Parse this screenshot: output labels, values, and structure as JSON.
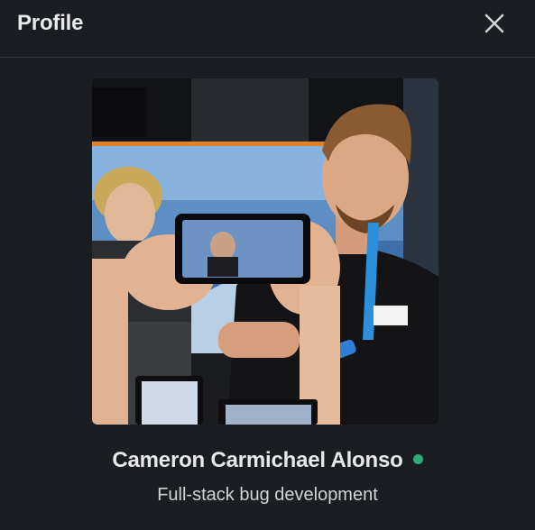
{
  "header": {
    "title": "Profile",
    "close_icon": "close-icon"
  },
  "profile": {
    "photo_alt": "Profile photo",
    "name": "Cameron Carmichael Alonso",
    "title": "Full-stack bug development",
    "presence": "active",
    "presence_color": "#2bac76"
  },
  "colors": {
    "background": "#1a1d21",
    "divider": "#34373b",
    "text_primary": "#e8e8e8",
    "text_secondary": "#d1d2d3"
  }
}
